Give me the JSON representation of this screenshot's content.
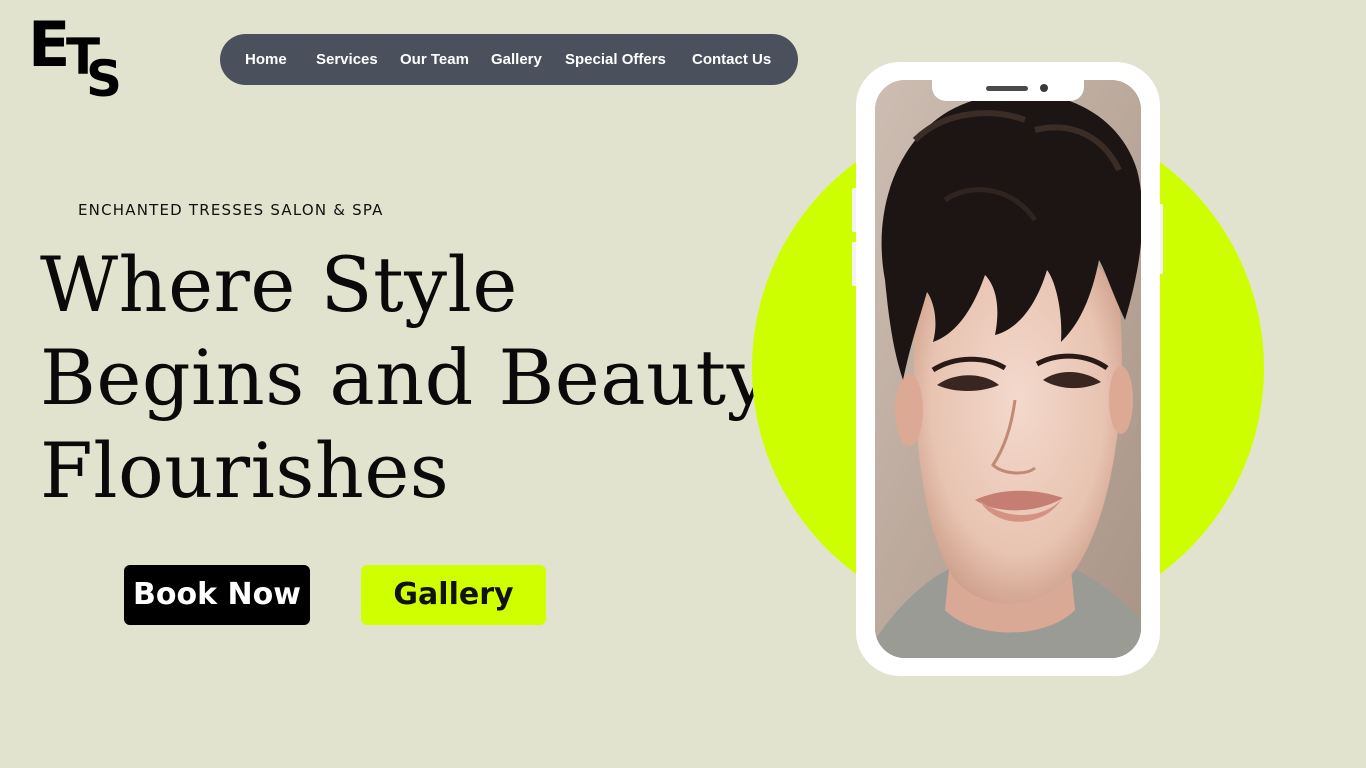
{
  "logo": {
    "e": "E",
    "t": "T",
    "s": "S"
  },
  "nav": {
    "items": [
      "Home",
      "Services",
      "Our Team",
      "Gallery",
      "Special Offers",
      "Contact Us"
    ]
  },
  "hero": {
    "tagline": "ENCHANTED TRESSES SALON & SPA",
    "headline_lines": [
      "Where Style",
      "Begins and Beauty",
      "Flourishes"
    ],
    "book_button": "Book Now",
    "gallery_button": "Gallery"
  },
  "colors": {
    "background": "#e1e3cf",
    "nav_bg": "#4a515c",
    "accent_lime": "#ceff00",
    "button_dark": "#000000"
  },
  "image": {
    "alt": "portrait of a man with tousled dark hair"
  }
}
